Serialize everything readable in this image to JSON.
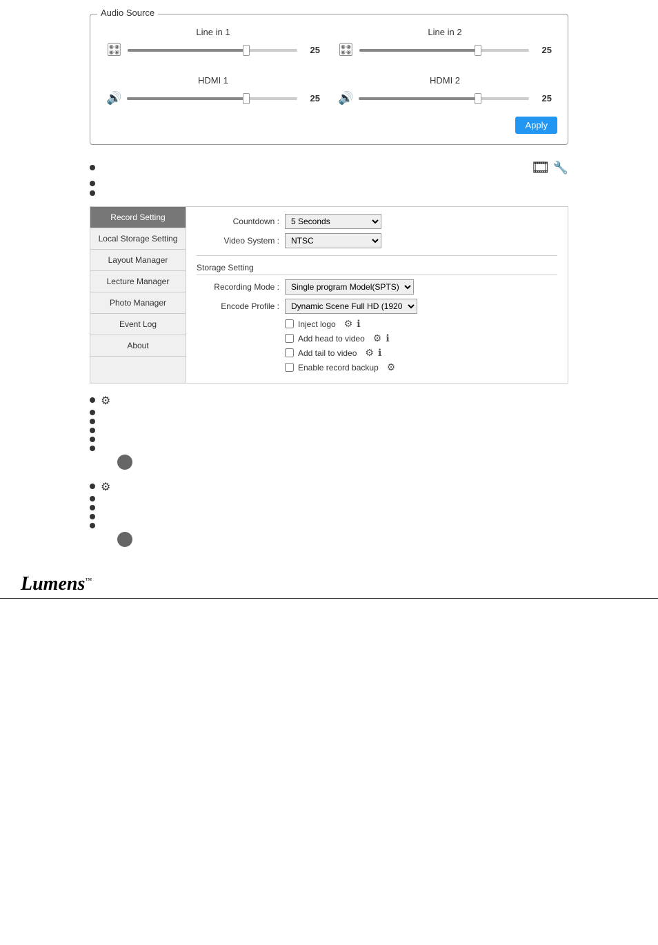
{
  "audioSource": {
    "label": "Audio Source",
    "channels": [
      {
        "name": "Line in 1",
        "value": 25
      },
      {
        "name": "Line in 2",
        "value": 25
      },
      {
        "name": "HDMI 1",
        "value": 25
      },
      {
        "name": "HDMI 2",
        "value": 25
      }
    ],
    "applyButton": "Apply"
  },
  "bullets1": [
    {
      "text": ""
    },
    {
      "text": ""
    },
    {
      "text": ""
    }
  ],
  "sidebar": {
    "items": [
      {
        "label": "Record Setting",
        "active": true
      },
      {
        "label": "Local Storage Setting",
        "active": false
      },
      {
        "label": "Layout Manager",
        "active": false
      },
      {
        "label": "Lecture Manager",
        "active": false
      },
      {
        "label": "Photo Manager",
        "active": false
      },
      {
        "label": "Event Log",
        "active": false
      },
      {
        "label": "About",
        "active": false
      }
    ]
  },
  "settings": {
    "countdown": {
      "label": "Countdown :",
      "value": "5 Seconds"
    },
    "videoSystem": {
      "label": "Video System :",
      "value": "NTSC"
    },
    "storageSetting": "Storage Setting",
    "recordingMode": {
      "label": "Recording Mode :",
      "value": "Single program Model(SPTS)"
    },
    "encodeProfile": {
      "label": "Encode Profile :",
      "value": "Dynamic Scene Full HD (1920"
    },
    "checkboxes": [
      {
        "label": "Inject logo",
        "checked": false
      },
      {
        "label": "Add head to video",
        "checked": false
      },
      {
        "label": "Add tail to video",
        "checked": false
      },
      {
        "label": "Enable record backup",
        "checked": false
      }
    ]
  },
  "lowerSection1": {
    "bullets": [
      {
        "text": "",
        "hasGear": true
      },
      {
        "text": ""
      },
      {
        "text": ""
      },
      {
        "text": ""
      },
      {
        "text": ""
      },
      {
        "text": ""
      }
    ]
  },
  "lowerSection2": {
    "bullets": [
      {
        "text": "",
        "hasGear": true
      },
      {
        "text": ""
      },
      {
        "text": ""
      },
      {
        "text": ""
      },
      {
        "text": ""
      }
    ]
  },
  "logo": {
    "text": "Lumens",
    "tm": "™"
  }
}
